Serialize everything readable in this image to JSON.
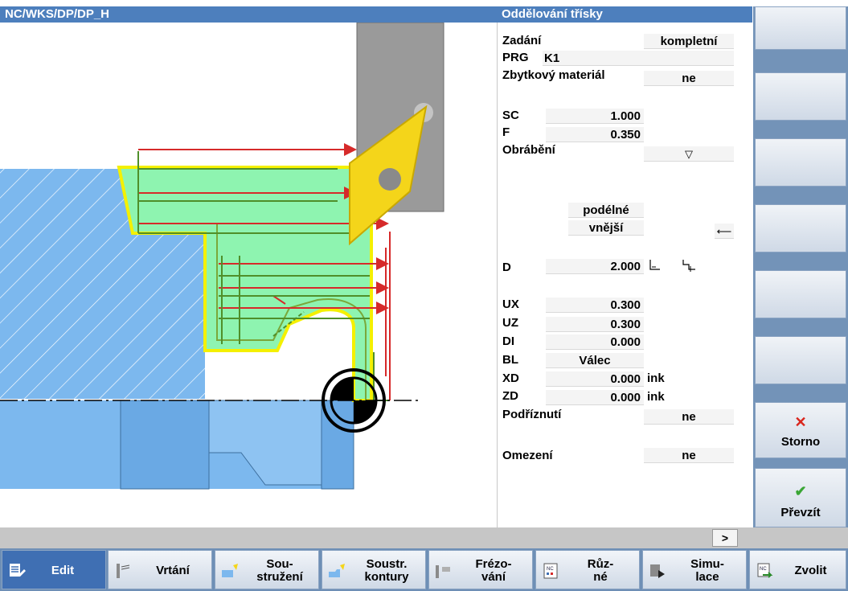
{
  "header": {
    "path": "NC/WKS/DP/DP_H",
    "form_title": "Oddělování třísky"
  },
  "form": {
    "zadani_label": "Zadání",
    "zadani_value": "kompletní",
    "prg_label": "PRG",
    "prg_value": "K1",
    "zbytkovy_label": "Zbytkový materiál",
    "zbytkovy_value": "ne",
    "sc_label": "SC",
    "sc_value": "1.000",
    "f_label": "F",
    "f_value": "0.350",
    "obrabeni_label": "Obrábění",
    "obrabeni_value": "▽",
    "podelne": "podélné",
    "vnejsi": "vnější",
    "arrow": "⟵",
    "d_label": "D",
    "d_value": "2.000",
    "ux_label": "UX",
    "ux_value": "0.300",
    "uz_label": "UZ",
    "uz_value": "0.300",
    "di_label": "DI",
    "di_value": "0.000",
    "bl_label": "BL",
    "bl_value": "Válec",
    "xd_label": "XD",
    "xd_value": "0.000",
    "xd_unit": "ink",
    "zd_label": "ZD",
    "zd_value": "0.000",
    "zd_unit": "ink",
    "podriznuti_label": "Podříznutí",
    "podriznuti_value": "ne",
    "omezeni_label": "Omezení",
    "omezeni_value": "ne"
  },
  "vertical_softkeys": {
    "storno": "Storno",
    "prevzit": "Převzít"
  },
  "statusbar": {
    "next": ">"
  },
  "horizontal_softkeys": [
    {
      "label": "Edit",
      "icon": "edit-icon"
    },
    {
      "label": "Vrtání",
      "icon": "drill-icon"
    },
    {
      "label": "Sou-\nstružení",
      "icon": "turning-icon"
    },
    {
      "label": "Soustr.\nkontury",
      "icon": "contour-turning-icon"
    },
    {
      "label": "Frézo-\nvání",
      "icon": "milling-icon"
    },
    {
      "label": "Růz-\nné",
      "icon": "various-icon"
    },
    {
      "label": "Simu-\nlace",
      "icon": "simulation-icon"
    },
    {
      "label": "Zvolit",
      "icon": "select-icon"
    }
  ],
  "colors": {
    "titlebar": "#4d7fbd",
    "workpiece": "#7cb8ee",
    "contour": "#f4f000",
    "roughing_path": "#d62a2a",
    "return_path": "#7aa83a",
    "finish_band": "#8ef4b0"
  }
}
